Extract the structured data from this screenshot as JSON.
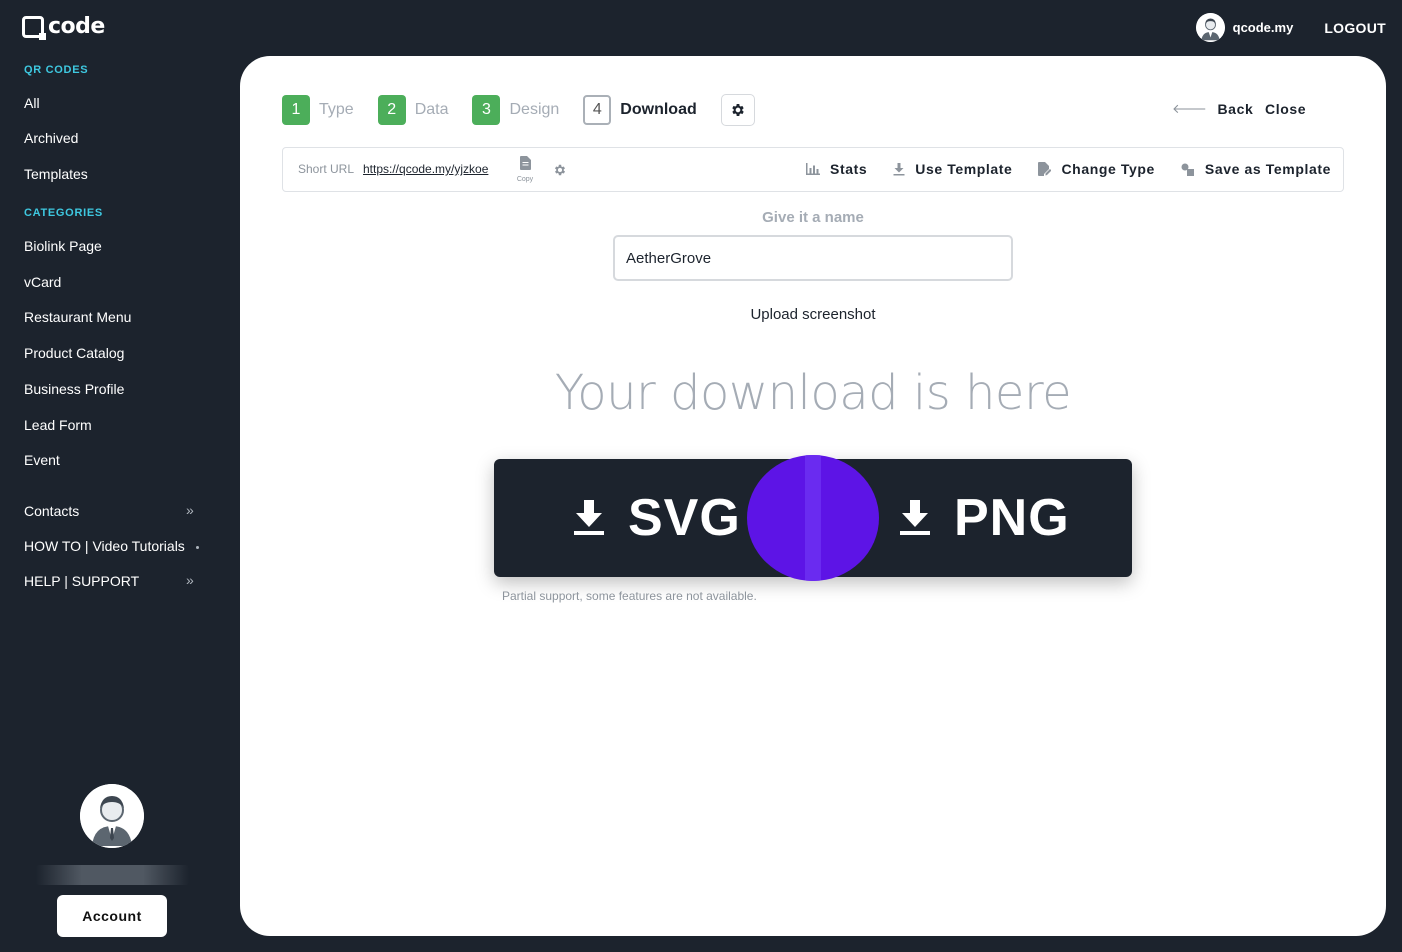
{
  "brand": {
    "name": "code"
  },
  "topbar": {
    "username": "qcode.my",
    "logout_label": "LOGOUT"
  },
  "sidebar": {
    "qr_section_title": "QR CODES",
    "qr_items": [
      "All",
      "Archived",
      "Templates"
    ],
    "categories_title": "CATEGORIES",
    "category_items": [
      "Biolink Page",
      "vCard",
      "Restaurant Menu",
      "Product Catalog",
      "Business Profile",
      "Lead Form",
      "Event"
    ],
    "extra_items": [
      "Contacts",
      "HOW TO | Video Tutorials",
      "HELP | SUPPORT"
    ],
    "account_label": "Account"
  },
  "steps": [
    {
      "num": "1",
      "label": "Type"
    },
    {
      "num": "2",
      "label": "Data"
    },
    {
      "num": "3",
      "label": "Design"
    },
    {
      "num": "4",
      "label": "Download"
    }
  ],
  "header_actions": {
    "back_label": "Back",
    "close_label": "Close",
    "back_arrow": "🡐"
  },
  "toolbar": {
    "short_url_label": "Short URL",
    "short_url": "https://qcode.my/yjzkoe",
    "copy_label": "Copy",
    "stats_label": "Stats",
    "use_template_label": "Use Template",
    "change_type_label": "Change Type",
    "save_template_label": "Save as Template"
  },
  "name_section": {
    "title": "Give it a name",
    "value": "AetherGrove",
    "upload_label": "Upload screenshot"
  },
  "download": {
    "heading": "Your download is here",
    "svg_label": "SVG",
    "png_label": "PNG",
    "note": "Partial support, some features are not available."
  },
  "colors": {
    "sidebar_bg": "#1c232d",
    "accent_cyan": "#3ec8e0",
    "step_green": "#4cae5a",
    "cursor_purple": "#5d14e6"
  }
}
